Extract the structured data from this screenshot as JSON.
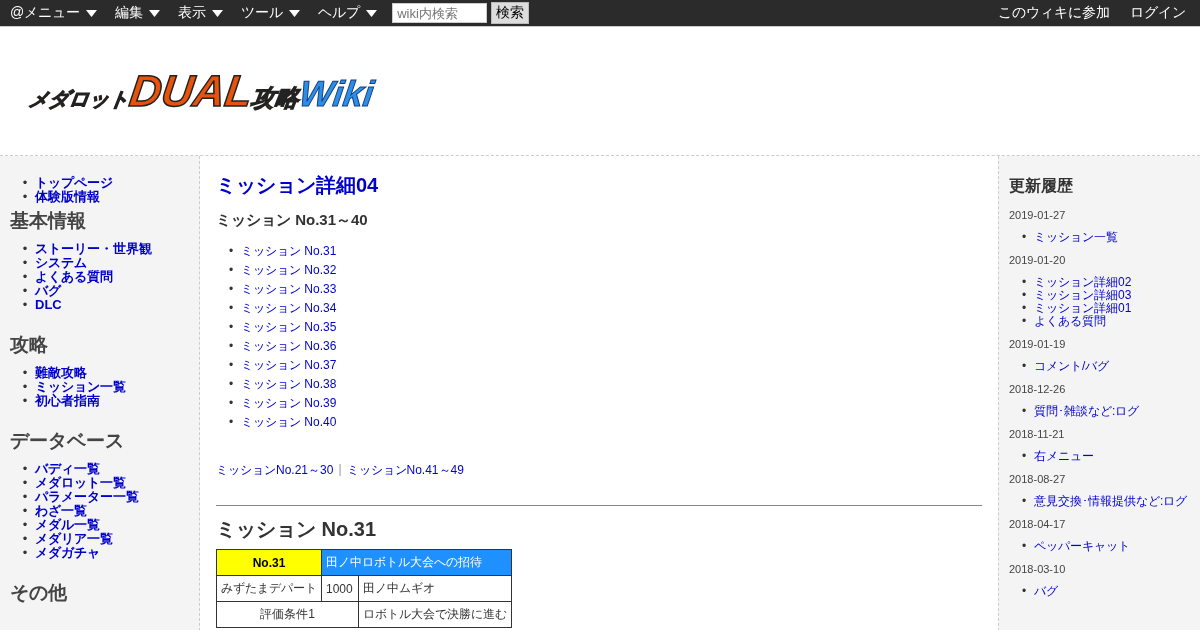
{
  "topbar": {
    "menus": [
      "@メニュー",
      "編集",
      "表示",
      "ツール",
      "ヘルプ"
    ],
    "search": {
      "placeholder": "wiki内検索",
      "button": "検索"
    },
    "links": [
      "このウィキに参加",
      "ログイン"
    ]
  },
  "logo": {
    "part_1": "メダロット",
    "part_2": "DUAL",
    "part_3": "攻略",
    "part_4": "Wiki"
  },
  "bullet": "•",
  "left_menu": [
    {
      "items": [
        "トップページ",
        "体験版情報"
      ]
    },
    {
      "heading": "基本情報",
      "items": [
        "ストーリー・世界観",
        "システム",
        "よくある質問",
        "バグ",
        "DLC"
      ]
    },
    {
      "heading": "攻略",
      "items": [
        "難敵攻略",
        "ミッション一覧",
        "初心者指南"
      ]
    },
    {
      "heading": "データベース",
      "items": [
        "バディ一覧",
        "メダロット一覧",
        "パラメーター一覧",
        "わざ一覧",
        "メダル一覧",
        "メダリア一覧",
        "メダガチャ"
      ]
    },
    {
      "heading": "その他"
    }
  ],
  "main": {
    "title": "ミッション詳細04",
    "subtitle": "ミッション No.31～40",
    "links": [
      "ミッション No.31",
      "ミッション No.32",
      "ミッション No.33",
      "ミッション No.34",
      "ミッション No.35",
      "ミッション No.36",
      "ミッション No.37",
      "ミッション No.38",
      "ミッション No.39",
      "ミッション No.40"
    ],
    "pager": {
      "prev": "ミッションNo.21～30",
      "separator": "|",
      "next": "ミッションNo.41～49"
    },
    "section_title": "ミッション No.31",
    "table": {
      "rows": [
        [
          {
            "text": "No.31",
            "kind": "number"
          },
          {
            "text": "田ノ中ロボトル大会への招待",
            "kind": "title"
          }
        ],
        [
          {
            "text": "みずたまデパート",
            "kind": "place"
          },
          {
            "text": "1000",
            "kind": "reward"
          },
          {
            "text": "田ノ中ムギオ",
            "kind": "client"
          }
        ],
        [
          {
            "text": "評価条件1",
            "kind": "label"
          },
          {
            "text": "ロボトル大会で決勝に進む",
            "kind": "condition"
          }
        ]
      ]
    }
  },
  "history": {
    "title": "更新履歴",
    "days": [
      {
        "date": "2019-01-27",
        "pages": [
          "ミッション一覧"
        ]
      },
      {
        "date": "2019-01-20",
        "pages": [
          "ミッション詳細02",
          "ミッション詳細03",
          "ミッション詳細01",
          "よくある質問"
        ]
      },
      {
        "date": "2019-01-19",
        "pages": [
          "コメント/バグ"
        ]
      },
      {
        "date": "2018-12-26",
        "pages": [
          "質問･雑談など:ログ"
        ]
      },
      {
        "date": "2018-11-21",
        "pages": [
          "右メニュー"
        ]
      },
      {
        "date": "2018-08-27",
        "pages": [
          "意見交換･情報提供など:ログ"
        ]
      },
      {
        "date": "2018-04-17",
        "pages": [
          "ペッパーキャット"
        ]
      },
      {
        "date": "2018-03-10",
        "pages": [
          "バグ"
        ]
      }
    ]
  }
}
